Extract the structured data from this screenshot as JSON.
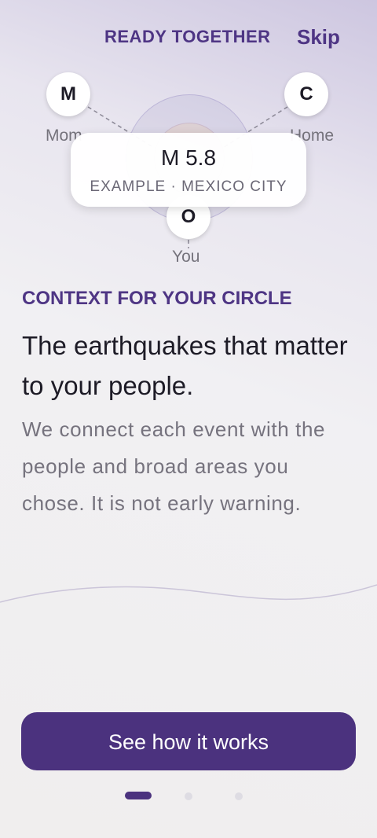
{
  "header": {
    "title": "READY TOGETHER",
    "skip_label": "Skip"
  },
  "diagram": {
    "nodes": [
      {
        "initial": "M",
        "label": "Mom"
      },
      {
        "initial": "C",
        "label": "Home"
      },
      {
        "initial": "O",
        "label": "You"
      }
    ],
    "quake": {
      "magnitude": "M 5.8",
      "place": "EXAMPLE · MEXICO CITY"
    }
  },
  "content": {
    "eyebrow": "CONTEXT FOR YOUR CIRCLE",
    "headline": "The earthquakes that matter to your people.",
    "body": "We connect each event with the people and broad areas you chose. It is not early warning."
  },
  "cta": {
    "label": "See how it works"
  },
  "pagination": {
    "total": 3,
    "current": 1
  },
  "colors": {
    "accent": "#4b327e",
    "brand_text": "#4e3584",
    "muted_text": "#76737e"
  }
}
